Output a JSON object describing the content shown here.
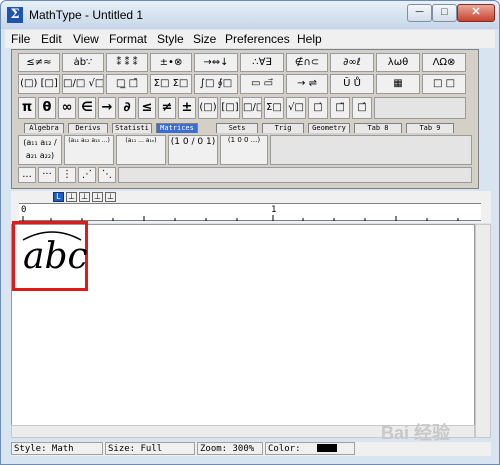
{
  "window": {
    "title": "MathType - Untitled 1",
    "controls": {
      "minimize": "─",
      "maximize": "□",
      "close": "✕"
    }
  },
  "menubar": {
    "items": [
      "File",
      "Edit",
      "View",
      "Format",
      "Style",
      "Size",
      "Preferences",
      "Help"
    ]
  },
  "palette_rows": {
    "row1": [
      "≤≠≈",
      "ȧb∵",
      "⁑ ⁑ ⁑",
      "±•⊗",
      "→⇔↓",
      "∴∀∃",
      "∉∩⊂",
      "∂∞ℓ",
      "λωθ",
      "ΛΩ⊗"
    ],
    "row2": [
      "(□) [□]",
      "□/□ √□",
      "□̲ □̄",
      "Σ□ Σ□",
      "∫□ ∮□",
      "▭ ▭⃗",
      "→ ⇌",
      "Ū Ů",
      "▦",
      "□ □"
    ],
    "row3": [
      "π",
      "θ",
      "∞",
      "∈",
      "→",
      "∂",
      "≤",
      "≠",
      "±",
      "(□)",
      "[□]",
      "□/□",
      "Σ□",
      "√□",
      "□̇",
      "□̈",
      "□̂"
    ],
    "row5": [
      "...",
      "···",
      "⋮",
      "⋰",
      "⋱"
    ]
  },
  "tabs": [
    "Algebra",
    "Derivs",
    "Statisti",
    "Matrices",
    "Sets",
    "Trig",
    "Geometry",
    "Tab 8",
    "Tab 9"
  ],
  "active_tab": "Matrices",
  "matrix_templates": [
    "(a₁₁ a₁₂ / a₂₁ a₂₂)",
    "(a₁₁ a₁₂ a₁₃ ...)",
    "(a₁₁ ... a₁ₙ)",
    "(1 0 / 0 1)",
    "(1 0 0 ...)"
  ],
  "ruler": {
    "tab_buttons": [
      "L",
      "⊥",
      "⊥",
      "⊥",
      "⊥"
    ],
    "labels": [
      "0",
      "1"
    ]
  },
  "document": {
    "equation_text": "abc",
    "accent": "⌒"
  },
  "statusbar": {
    "style": "Style: Math",
    "size": "Size: Full",
    "zoom": "Zoom: 300%",
    "color": "Color:"
  },
  "watermark": "Bai 经验"
}
